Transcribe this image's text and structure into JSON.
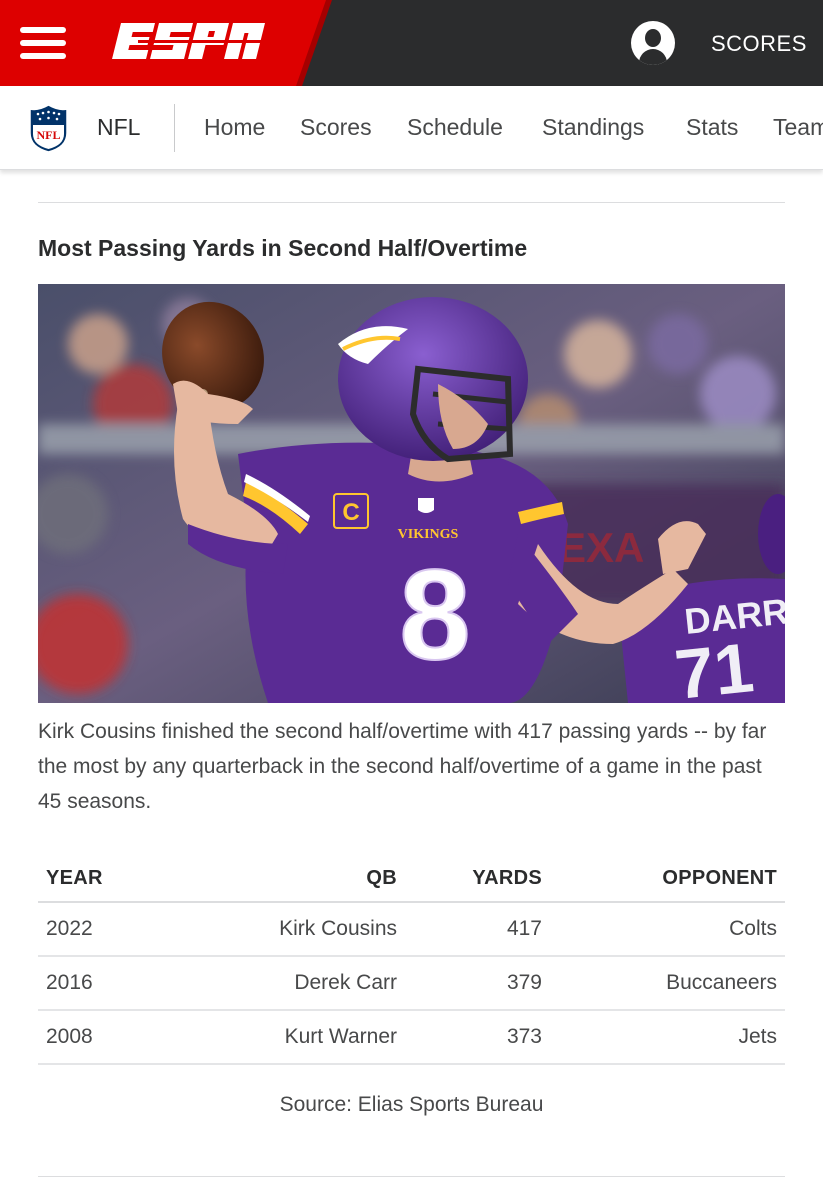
{
  "header": {
    "logo_text": "ESPN",
    "scores_label": "SCORES",
    "menu_icon": "hamburger-menu-icon",
    "profile_icon": "user-profile-icon"
  },
  "subnav": {
    "league": "NFL",
    "league_logo": "nfl-shield-logo",
    "items": [
      "Home",
      "Scores",
      "Schedule",
      "Standings",
      "Stats",
      "Teams"
    ]
  },
  "article": {
    "title": "Most Passing Yards in Second Half/Overtime",
    "image": {
      "jersey_number": "8",
      "jersey_text": "VIKINGS",
      "captain_patch": "C",
      "background_jersey_name": "DARRIS",
      "background_jersey_number": "71"
    },
    "caption": "Kirk Cousins finished the second half/overtime with 417 passing yards -- by far the most by any quarterback in the second half/overtime of a game in the past 45 seasons."
  },
  "table": {
    "headers": [
      "YEAR",
      "QB",
      "YARDS",
      "OPPONENT"
    ],
    "rows": [
      [
        "2022",
        "Kirk Cousins",
        "417",
        "Colts"
      ],
      [
        "2016",
        "Derek Carr",
        "379",
        "Buccaneers"
      ],
      [
        "2008",
        "Kurt Warner",
        "373",
        "Jets"
      ]
    ]
  },
  "source": "Source: Elias Sports Bureau",
  "colors": {
    "espn_red": "#dd0000",
    "header_dark": "#2b2c2d",
    "vikings_purple": "#5a2b94",
    "vikings_gold": "#ffc62f"
  }
}
